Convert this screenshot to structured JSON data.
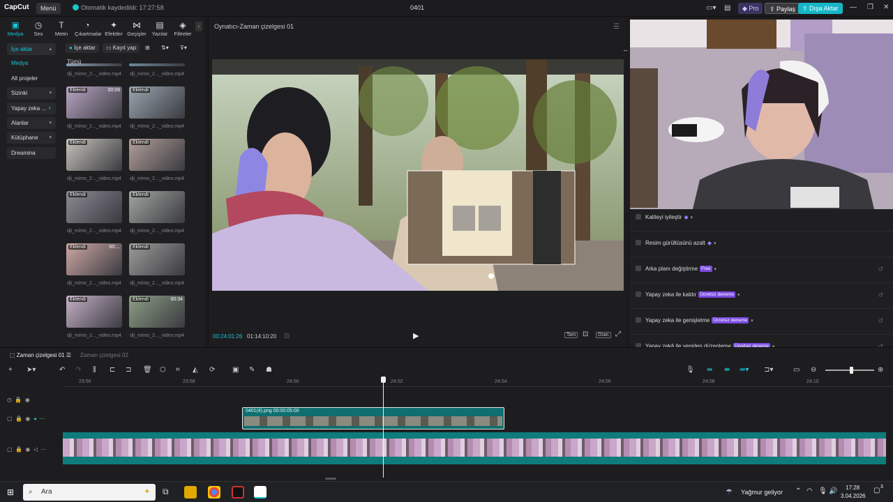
{
  "titlebar": {
    "logo": "CapCut",
    "menu": "Menü",
    "saved": "Otomatik kaydedildi: 17:27:58",
    "doc": "0401",
    "pro": "Pro",
    "share": "Paylaş",
    "export": "Dışa Aktar"
  },
  "toolbar": [
    "Medya",
    "Ses",
    "Metin",
    "Çıkartmalar",
    "Efektler",
    "Geçişler",
    "Yazılar",
    "Filtreler"
  ],
  "sidebar": {
    "import": "İçe aktar",
    "items": [
      "Medya",
      "Alt projeler",
      "Sizinki",
      "Yapay zeka ...",
      "Alanlar",
      "Kütüphane",
      "Dreamina"
    ]
  },
  "media_toolbar": {
    "import": "İçe aktar",
    "record": "Kayıt yap"
  },
  "media_filter": "Tümü",
  "media": [
    {
      "caption": "dji_mimo_2..._video.mp4",
      "badge": "",
      "dur": ""
    },
    {
      "caption": "dji_mimo_2..._video.mp4",
      "badge": "",
      "dur": ""
    },
    {
      "caption": "dji_mimo_2..._video.mp4",
      "badge": "Eklendi",
      "dur": "00:09"
    },
    {
      "caption": "dji_mimo_2..._video.mp4",
      "badge": "Eklendi",
      "dur": ""
    },
    {
      "caption": "dji_mimo_2..._video.mp4",
      "badge": "Eklendi",
      "dur": ""
    },
    {
      "caption": "dji_mimo_2..._video.mp4",
      "badge": "Eklendi",
      "dur": ""
    },
    {
      "caption": "dji_mimo_2..._video.mp4",
      "badge": "Eklendi",
      "dur": ""
    },
    {
      "caption": "dji_mimo_2..._video.mp4",
      "badge": "Eklendi",
      "dur": ""
    },
    {
      "caption": "dji_mimo_2..._video.mp4",
      "badge": "Eklendi",
      "dur": "00:..."
    },
    {
      "caption": "dji_mimo_2..._video.mp4",
      "badge": "Eklendi",
      "dur": ""
    },
    {
      "caption": "dji_mimo_2..._video.mp4",
      "badge": "Eklendi",
      "dur": ""
    },
    {
      "caption": "dji_mimo_2..._video.mp4",
      "badge": "Eklendi",
      "dur": "00:34"
    }
  ],
  "player": {
    "title": "Oynatıcı-Zaman çizelgesi 01",
    "current": "00:24:01:26",
    "total": "01:14:10:20",
    "full": "Tam",
    "ratio": "Oran"
  },
  "features": [
    {
      "label": "Kaliteyi iyileştir",
      "tag": "",
      "reset": false
    },
    {
      "label": "Resim gürültüsünü azalt",
      "tag": "",
      "reset": false
    },
    {
      "label": "Arka planı değiştirme",
      "tag": "Free",
      "reset": true
    },
    {
      "label": "Yapay zeka ile kaldır",
      "tag": "Ücretsiz deneme",
      "reset": true
    },
    {
      "label": "Yapay zeka ile genişletme",
      "tag": "Ücretsiz deneme",
      "reset": true
    },
    {
      "label": "Yapay zekâ ile yeniden düzenleme",
      "tag": "Ücretsiz deneme",
      "reset": true
    }
  ],
  "timeline": {
    "tab1": "Zaman çizelgesi 01",
    "tab2": "Zaman çizelgesi 02",
    "ruler": [
      "23:56",
      "23:58",
      "24:00",
      "24:02",
      "24:04",
      "24:06",
      "24:08",
      "24:10"
    ],
    "overlay_clip": "0401(4).png  00:00:05:00"
  },
  "taskbar": {
    "search": "Ara",
    "weather": "Yağmur geliyor",
    "time": "17:28",
    "date": "3.04.2026",
    "notif": "3"
  },
  "colors": {
    "accent": "#19c6d6",
    "pro": "#7b4be0",
    "clip": "#0f7c7c"
  }
}
